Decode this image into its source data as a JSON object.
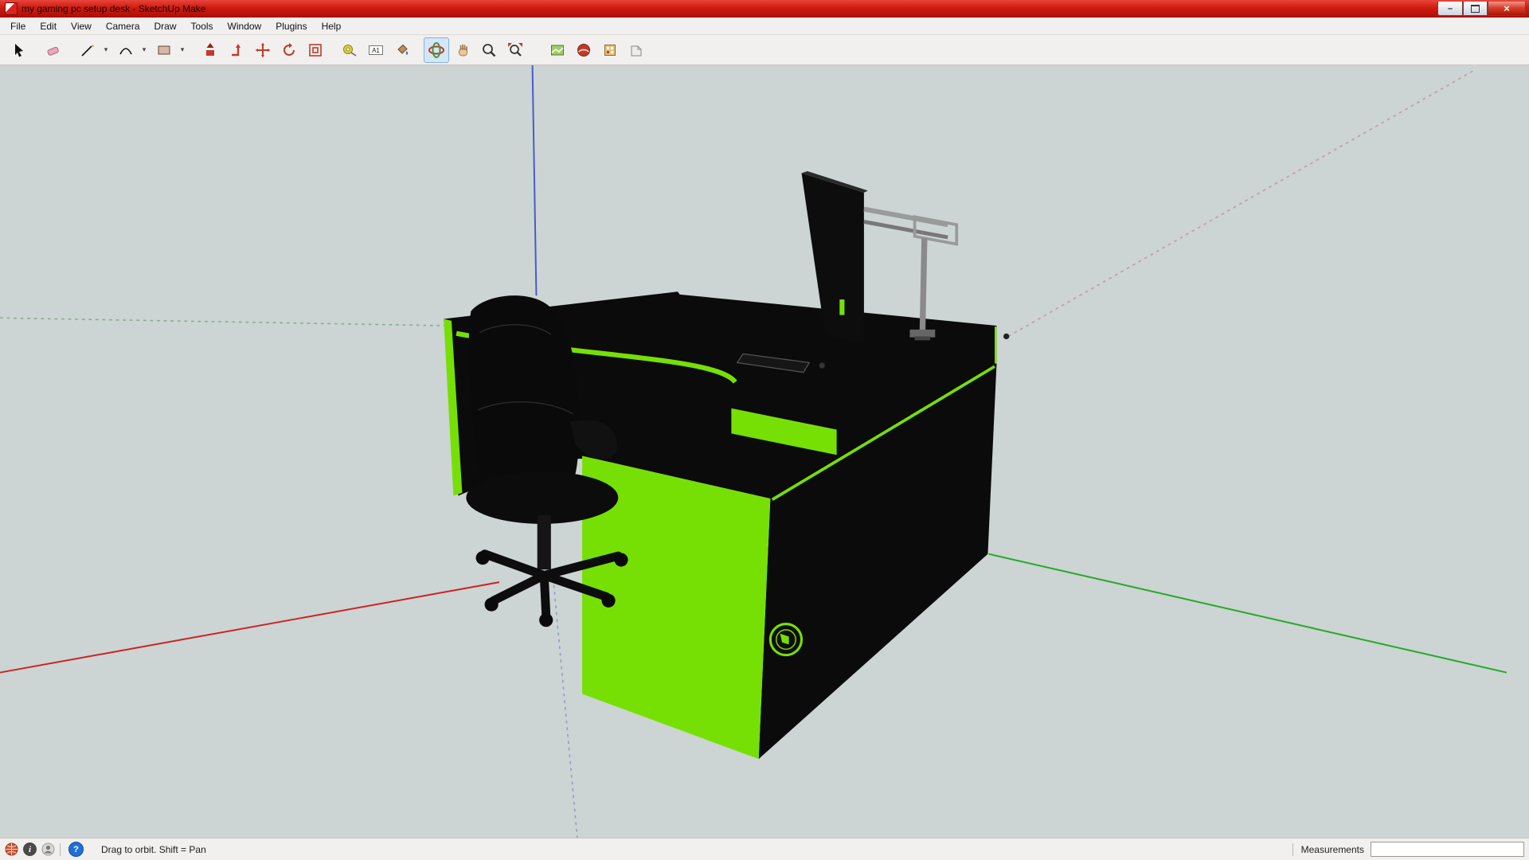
{
  "window": {
    "title": "my gaming pc setup desk - SketchUp Make",
    "controls": {
      "minimize_glyph": "–",
      "close_glyph": "×"
    }
  },
  "menu": {
    "items": [
      "File",
      "Edit",
      "View",
      "Camera",
      "Draw",
      "Tools",
      "Window",
      "Plugins",
      "Help"
    ]
  },
  "toolbar": {
    "dimension_icon_label": "A1",
    "dropdown_glyph": "▾"
  },
  "canvas": {
    "colors": {
      "background": "#ccd4d4",
      "desk_black": "#0b0b0b",
      "accent_green": "#76e005",
      "axis_red": "#cc2222",
      "axis_green": "#22aa22",
      "axis_blue": "#4a58c8",
      "axis_blue_dotted": "#8f9ec7",
      "axis_green_dotted": "#86ad86",
      "axis_red_dotted": "#c59a9a",
      "arm_gray": "#9a9a9a"
    }
  },
  "status_bar": {
    "hint": "Drag to orbit.  Shift = Pan",
    "info_glyph": "i",
    "help_glyph": "?",
    "measurements_label": "Measurements",
    "measurements_value": ""
  }
}
